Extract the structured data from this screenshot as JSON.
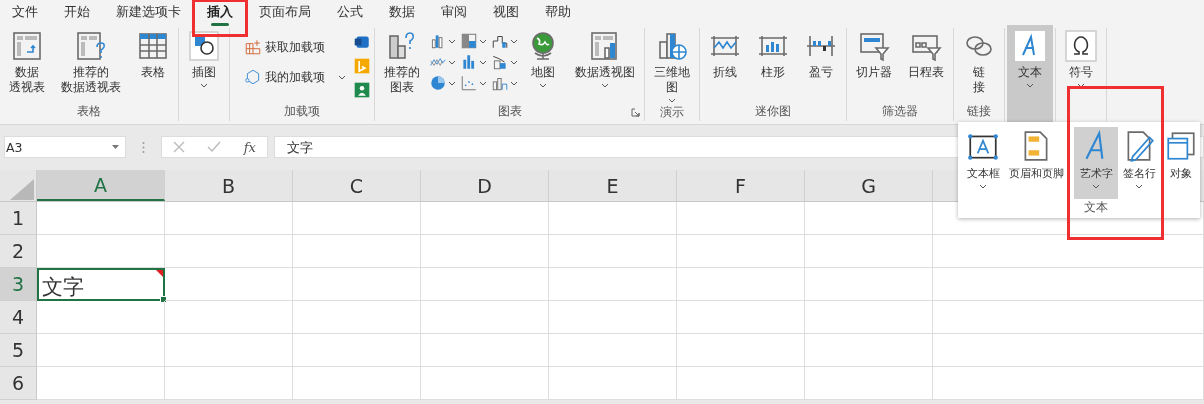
{
  "menu_tabs": [
    {
      "label": "文件",
      "selected": false,
      "highlighted": false
    },
    {
      "label": "开始",
      "selected": false,
      "highlighted": false
    },
    {
      "label": "新建选项卡",
      "selected": false,
      "highlighted": false
    },
    {
      "label": "插入",
      "selected": true,
      "highlighted": true
    },
    {
      "label": "页面布局",
      "selected": false,
      "highlighted": false
    },
    {
      "label": "公式",
      "selected": false,
      "highlighted": false
    },
    {
      "label": "数据",
      "selected": false,
      "highlighted": false
    },
    {
      "label": "审阅",
      "selected": false,
      "highlighted": false
    },
    {
      "label": "视图",
      "selected": false,
      "highlighted": false
    },
    {
      "label": "帮助",
      "selected": false,
      "highlighted": false
    }
  ],
  "ribbon_groups": [
    {
      "label": "表格",
      "items": [
        {
          "kind": "large",
          "label_lines": [
            "数据",
            "透视表"
          ],
          "caret": false,
          "expanded": false
        },
        {
          "kind": "large",
          "label_lines": [
            "推荐的",
            "数据透视表"
          ],
          "caret": false,
          "expanded": false
        },
        {
          "kind": "large",
          "label_lines": [
            "表格"
          ],
          "caret": false,
          "expanded": false
        }
      ]
    },
    {
      "items": [
        {
          "kind": "large",
          "label_lines": [
            "插图"
          ],
          "caret": true,
          "expanded": false
        }
      ]
    },
    {
      "label": "加载项",
      "items": [
        {
          "kind": "stacked",
          "entries": [
            {
              "label": "获取加载项",
              "caret": false
            },
            {
              "label": "我的加载项",
              "caret": true
            }
          ]
        },
        {
          "kind": "icon-column"
        }
      ]
    },
    {
      "label": "图表",
      "launcher": true,
      "items": [
        {
          "kind": "large",
          "label_lines": [
            "推荐的",
            "图表"
          ],
          "caret": false,
          "expanded": false
        },
        {
          "kind": "icon-grid"
        },
        {
          "kind": "large",
          "label_lines": [
            "地图"
          ],
          "caret": true,
          "expanded": false
        },
        {
          "kind": "large",
          "label_lines": [
            "数据透视图"
          ],
          "caret": true,
          "expanded": false
        }
      ]
    },
    {
      "label": "演示",
      "items": [
        {
          "kind": "large",
          "label_lines": [
            "三维地",
            "图"
          ],
          "caret": true,
          "expanded": false
        }
      ]
    },
    {
      "label": "迷你图",
      "items": [
        {
          "kind": "large",
          "label_lines": [
            "折线"
          ],
          "caret": false,
          "expanded": false
        },
        {
          "kind": "large",
          "label_lines": [
            "柱形"
          ],
          "caret": false,
          "expanded": false
        },
        {
          "kind": "large",
          "label_lines": [
            "盈亏"
          ],
          "caret": false,
          "expanded": false
        }
      ]
    },
    {
      "label": "筛选器",
      "items": [
        {
          "kind": "large",
          "label_lines": [
            "切片器"
          ],
          "caret": false,
          "expanded": false
        },
        {
          "kind": "large",
          "label_lines": [
            "日程表"
          ],
          "caret": false,
          "expanded": false
        }
      ]
    },
    {
      "label": "链接",
      "items": [
        {
          "kind": "large",
          "label_lines": [
            "链",
            "接"
          ],
          "caret": false,
          "expanded": false
        }
      ]
    },
    {
      "items": [
        {
          "kind": "large",
          "label_lines": [
            "文本"
          ],
          "caret": true,
          "expanded": true
        }
      ]
    },
    {
      "items": [
        {
          "kind": "large",
          "label_lines": [
            "符号"
          ],
          "caret": true,
          "expanded": false
        }
      ]
    }
  ],
  "formula_bar": {
    "name_box": "A3",
    "function_label": "fx",
    "value": "文字"
  },
  "sheet": {
    "columns": [
      {
        "label": "A",
        "selected": true
      },
      {
        "label": "B",
        "selected": false
      },
      {
        "label": "C",
        "selected": false
      },
      {
        "label": "D",
        "selected": false
      },
      {
        "label": "E",
        "selected": false
      },
      {
        "label": "F",
        "selected": false
      },
      {
        "label": "G",
        "selected": false
      }
    ],
    "rows": [
      {
        "label": "1",
        "selected": false,
        "cells": []
      },
      {
        "label": "2",
        "selected": false,
        "cells": []
      },
      {
        "label": "3",
        "selected": true,
        "cells": [
          {
            "text": "文字",
            "active": true,
            "comment": true
          }
        ]
      },
      {
        "label": "4",
        "selected": false,
        "cells": []
      },
      {
        "label": "5",
        "selected": false,
        "cells": []
      },
      {
        "label": "6",
        "selected": false,
        "cells": []
      }
    ]
  },
  "text_dropdown": {
    "label": "文本",
    "highlight_frame": true,
    "items": [
      {
        "label": "文本框",
        "caret": true,
        "selected": false
      },
      {
        "label": "页眉和页脚",
        "caret": false,
        "selected": false
      },
      {
        "label": "艺术字",
        "caret": true,
        "selected": true
      },
      {
        "label": "签名行",
        "caret": true,
        "selected": false
      },
      {
        "label": "对象",
        "caret": false,
        "selected": false
      }
    ]
  }
}
